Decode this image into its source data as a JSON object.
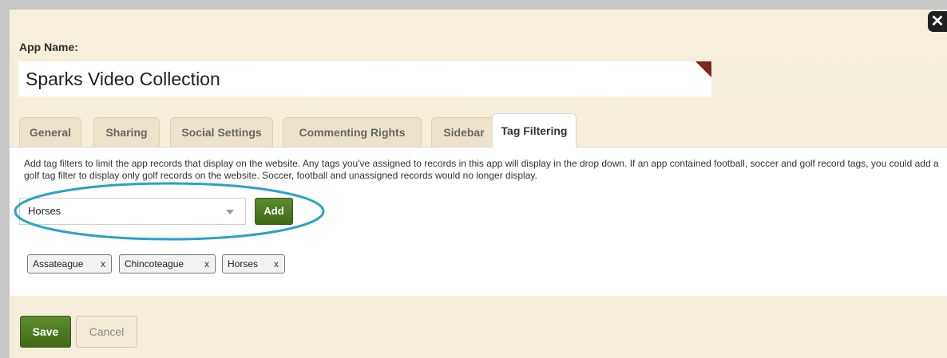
{
  "dialog": {
    "close_label": "✕",
    "app_name_label": "App Name:",
    "app_name_value": "Sparks Video Collection"
  },
  "tabs": [
    {
      "label": "General",
      "active": false
    },
    {
      "label": "Sharing",
      "active": false
    },
    {
      "label": "Social Settings",
      "active": false
    },
    {
      "label": "Commenting Rights",
      "active": false
    },
    {
      "label": "Sidebar",
      "active": false
    },
    {
      "label": "Tag Filtering",
      "active": true
    }
  ],
  "tag_filtering": {
    "description": "Add tag filters to limit the app records that display on the website. Any tags you've assigned to records in this app will display in the drop down. If an app contained football, soccer and golf record tags, you could add a golf tag filter to display only golf records on the website. Soccer, football and unassigned records would no longer display.",
    "select_value": "Horses",
    "add_label": "Add",
    "tags": [
      {
        "label": "Assateague",
        "remove": "x"
      },
      {
        "label": "Chincoteague",
        "remove": "x"
      },
      {
        "label": "Horses",
        "remove": "x"
      }
    ]
  },
  "footer": {
    "save_label": "Save",
    "cancel_label": "Cancel"
  },
  "colors": {
    "primary_button": "#4a7a22",
    "highlight_circle": "#2aa3c4",
    "background": "#f7efdc"
  },
  "icons": {
    "close": "close-icon",
    "dropdown": "chevron-down-icon",
    "corner": "required-corner-icon"
  }
}
